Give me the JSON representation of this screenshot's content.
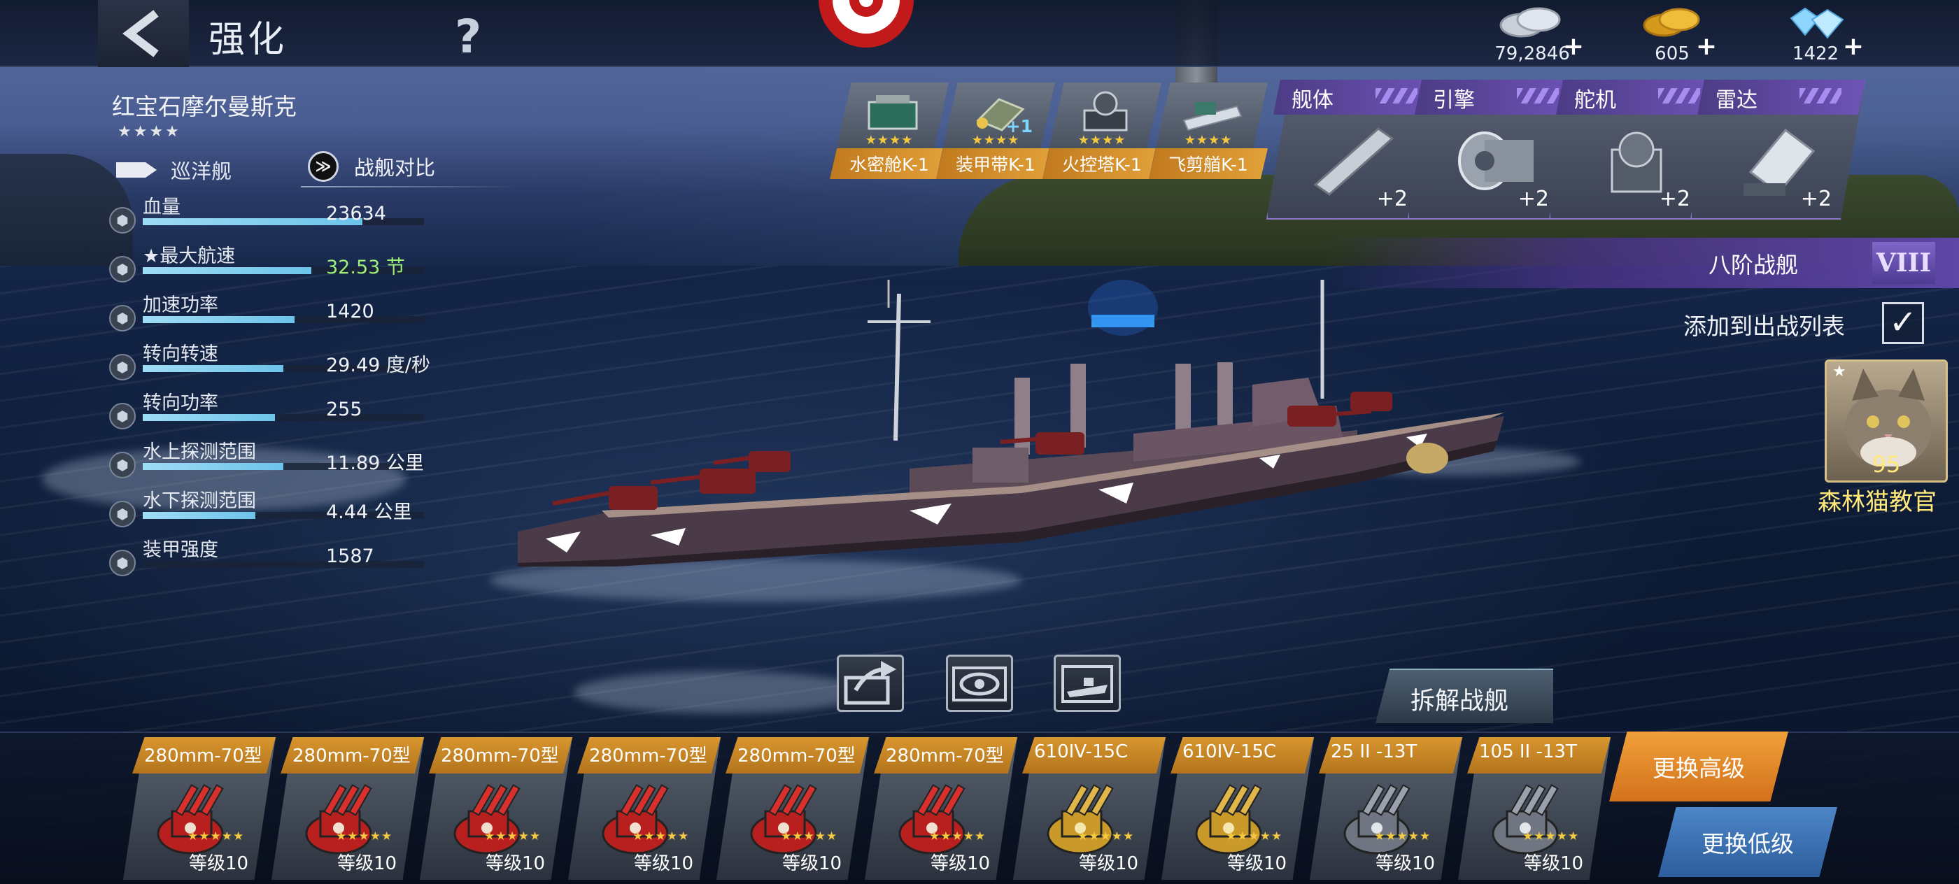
{
  "header": {
    "title": "强化",
    "help": "?"
  },
  "currencies": [
    {
      "name": "silver-coins",
      "amount": "79,2846",
      "plus": "+"
    },
    {
      "name": "gold-coins",
      "amount": "605",
      "plus": "+"
    },
    {
      "name": "diamonds",
      "amount": "1422",
      "plus": "+"
    }
  ],
  "ship": {
    "name": "红宝石摩尔曼斯克",
    "stars": "★★★★",
    "class": "巡洋舰",
    "compare": "战舰对比",
    "compare_icon": "≫"
  },
  "stats": [
    {
      "label": "血量",
      "value": "23634",
      "fill": 0.78,
      "highlight": false
    },
    {
      "label": "★最大航速",
      "value": "32.53 节",
      "fill": 0.6,
      "highlight": true
    },
    {
      "label": "加速功率",
      "value": "1420",
      "fill": 0.54,
      "highlight": false
    },
    {
      "label": "转向转速",
      "value": "29.49 度/秒",
      "fill": 0.5,
      "highlight": false
    },
    {
      "label": "转向功率",
      "value": "255",
      "fill": 0.47,
      "highlight": false
    },
    {
      "label": "水上探测范围",
      "value": "11.89 公里",
      "fill": 0.5,
      "highlight": false
    },
    {
      "label": "水下探测范围",
      "value": "4.44 公里",
      "fill": 0.4,
      "highlight": false
    },
    {
      "label": "装甲强度",
      "value": "1587",
      "fill": 0.0,
      "highlight": false
    }
  ],
  "equipment": [
    {
      "label": "水密舱K-1",
      "stars": "★★★★",
      "extra": ""
    },
    {
      "label": "装甲带K-1",
      "stars": "★★★★",
      "extra": "+1"
    },
    {
      "label": "火控塔K-1",
      "stars": "★★★★",
      "extra": ""
    },
    {
      "label": "飞剪艏K-1",
      "stars": "★★★★",
      "extra": ""
    }
  ],
  "modules": [
    {
      "name": "舰体",
      "plus": "+2",
      "icon": "hull-icon"
    },
    {
      "name": "引擎",
      "plus": "+2",
      "icon": "engine-icon"
    },
    {
      "name": "舵机",
      "plus": "+2",
      "icon": "rudder-icon"
    },
    {
      "name": "雷达",
      "plus": "+2",
      "icon": "radar-icon"
    }
  ],
  "tier": {
    "label": "八阶战舰",
    "roman": "VIII"
  },
  "add_to_battle": {
    "label": "添加到出战列表",
    "checked": "✓"
  },
  "officer": {
    "name": "森林猫教官",
    "level": "95",
    "star": "★"
  },
  "dismantle": "拆解战舰",
  "weapons": [
    {
      "name": "280mm-70型",
      "stars": "★★★★★",
      "level": "等级10",
      "type": "red"
    },
    {
      "name": "280mm-70型",
      "stars": "★★★★★",
      "level": "等级10",
      "type": "red"
    },
    {
      "name": "280mm-70型",
      "stars": "★★★★★",
      "level": "等级10",
      "type": "red"
    },
    {
      "name": "280mm-70型",
      "stars": "★★★★★",
      "level": "等级10",
      "type": "red"
    },
    {
      "name": "280mm-70型",
      "stars": "★★★★★",
      "level": "等级10",
      "type": "red"
    },
    {
      "name": "280mm-70型",
      "stars": "★★★★★",
      "level": "等级10",
      "type": "red"
    },
    {
      "name": "610IV-15C",
      "stars": "★★★★★",
      "level": "等级10",
      "type": "gold"
    },
    {
      "name": "610IV-15C",
      "stars": "★★★★★",
      "level": "等级10",
      "type": "gold"
    },
    {
      "name": "25 II -13T",
      "stars": "★★★★★",
      "level": "等级10",
      "type": "gray"
    },
    {
      "name": "105 II -13T",
      "stars": "★★★★★",
      "level": "等级10",
      "type": "gray"
    }
  ],
  "swap": {
    "high": "更换高级",
    "low": "更换低级"
  },
  "colors": {
    "accent_gold": "#e1a33a",
    "purple": "#6e54b8",
    "green_stat": "#9cf07a",
    "officer_gold": "#ffe97a"
  }
}
